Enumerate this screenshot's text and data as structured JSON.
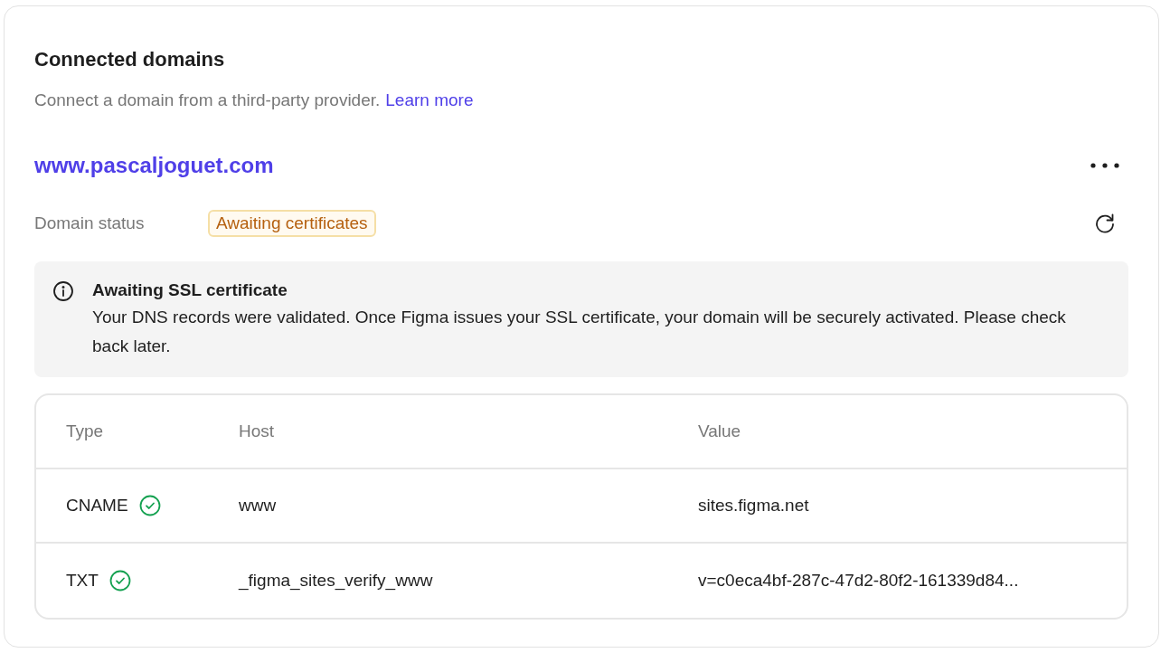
{
  "section": {
    "title": "Connected domains",
    "description": "Connect a domain from a third-party provider.",
    "learn_more_link": "Learn more"
  },
  "domain": {
    "name": "www.pascaljoguet.com",
    "status_label": "Domain status",
    "status_badge": {
      "text": "Awaiting certificates",
      "kind": "warning"
    }
  },
  "alert": {
    "title": "Awaiting SSL certificate",
    "message": "Your DNS records were validated. Once Figma issues your SSL certificate, your domain will be securely activated. Please check back later."
  },
  "records": {
    "columns": [
      "Type",
      "Host",
      "Value"
    ],
    "rows": [
      {
        "type": "CNAME",
        "verified": true,
        "host": "www",
        "value": "sites.figma.net"
      },
      {
        "type": "TXT",
        "verified": true,
        "host": "_figma_sites_verify_www",
        "value": "v=c0eca4bf-287c-47d2-80f2-161339d84..."
      }
    ]
  }
}
